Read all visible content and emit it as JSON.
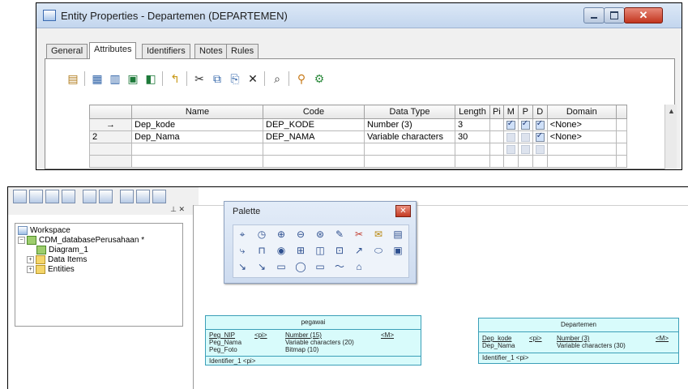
{
  "dialog": {
    "title": "Entity Properties - Departemen (DEPARTEMEN)",
    "close_glyph": "✕",
    "tabs": [
      "General",
      "Attributes",
      "Identifiers",
      "Notes",
      "Rules"
    ],
    "active_tab": "Attributes",
    "toolbar_icons": [
      "properties-icon",
      "add-row-icon",
      "insert-row-icon",
      "add-attributes-icon",
      "reuse-attributes-icon",
      "move-up-icon",
      "cut-icon",
      "copy-icon",
      "paste-icon",
      "delete-icon",
      "find-icon",
      "filter-icon",
      "customize-icon"
    ],
    "grid": {
      "columns": [
        "",
        "Name",
        "Code",
        "Data Type",
        "Length",
        "Pi",
        "M",
        "P",
        "D",
        "Domain",
        ""
      ],
      "rows": [
        {
          "marker": "→",
          "name": "Dep_kode",
          "code": "DEP_KODE",
          "data_type": "Number (3)",
          "length": "3",
          "m": true,
          "p": true,
          "d": true,
          "domain": "<None>"
        },
        {
          "marker": "2",
          "name": "Dep_Nama",
          "code": "DEP_NAMA",
          "data_type": "Variable characters",
          "length": "30",
          "m": false,
          "p": false,
          "d": true,
          "domain": "<None>"
        }
      ]
    }
  },
  "explorer": {
    "controls": "⊥ ✕",
    "items": [
      {
        "label": "Workspace",
        "icon": "workspace-icon"
      },
      {
        "label": "CDM_databasePerusahaan *",
        "icon": "model-icon"
      },
      {
        "label": "Diagram_1",
        "icon": "diagram-icon"
      },
      {
        "label": "Data Items",
        "icon": "folder-icon"
      },
      {
        "label": "Entities",
        "icon": "folder-icon"
      }
    ]
  },
  "palette": {
    "title": "Palette",
    "close_glyph": "✕",
    "tools": [
      "⌖",
      "◷",
      "⊕",
      "⊖",
      "⊛",
      "✎",
      "✂",
      "✉",
      "▤",
      "⤷",
      "⊓",
      "◉",
      "⊞",
      "◫",
      "⊡",
      "↗",
      "⬭",
      "▣",
      "↘",
      "↘",
      "▭",
      "◯",
      "▭",
      "〜",
      "⌂"
    ]
  },
  "entities": [
    {
      "name": "pegawai",
      "rows": [
        {
          "attr": "Peg_NIP",
          "key": "<pi>",
          "type": "Number (15)",
          "mark": "<M>"
        },
        {
          "attr": "Peg_Nama",
          "key": "",
          "type": "Variable characters (20)",
          "mark": ""
        },
        {
          "attr": "Peg_Foto",
          "key": "",
          "type": "Bitmap (10)",
          "mark": ""
        }
      ],
      "identifier": "Identifier_1  <pi>"
    },
    {
      "name": "Departemen",
      "rows": [
        {
          "attr": "Dep_kode",
          "key": "<pi>",
          "type": "Number (3)",
          "mark": "<M>"
        },
        {
          "attr": "Dep_Nama",
          "key": "",
          "type": "Variable characters (30)",
          "mark": ""
        }
      ],
      "identifier": "Identifier_1  <pi>"
    }
  ]
}
